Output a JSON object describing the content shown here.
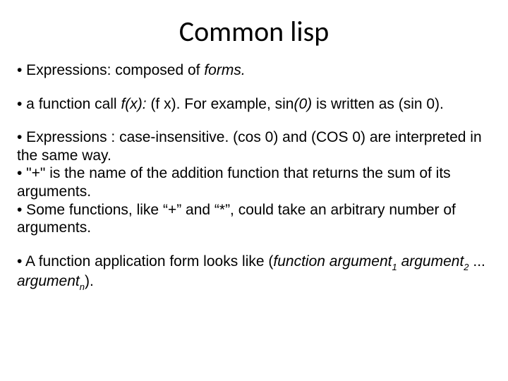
{
  "title": "Common lisp",
  "bullets": {
    "b1_a": "• Expressions:  composed of ",
    "b1_b": "forms.",
    "b2_a": "• a function call ",
    "b2_b": "f(x): ",
    "b2_c": " (f x). For example, sin",
    "b2_d": "(0)",
    "b2_e": " is written as (sin 0).",
    "b3": "• Expressions : case-insensitive. (cos 0) and (COS 0)  are interpreted in the same way.",
    "b4": "• \"+\" is the name of the addition function that returns the sum of its arguments.",
    "b5": "•  Some functions, like “+” and “*”, could take an arbitrary number of arguments.",
    "b6_a": "• A function application form looks like ",
    "b6_b": "(",
    "b6_c": "function argument",
    "b6_d": "1",
    "b6_e": " argument",
    "b6_f": "2",
    "b6_g": " ... ",
    "b6_h": "argument",
    "b6_i": "n",
    "b6_j": ")."
  }
}
